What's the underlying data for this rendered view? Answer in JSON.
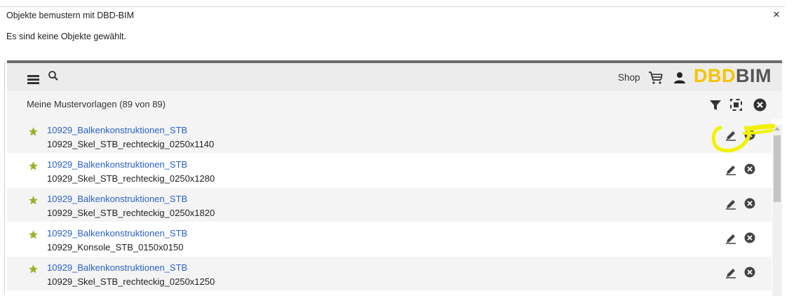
{
  "dialog": {
    "title": "Objekte bemustern mit DBD-BIM",
    "close_symbol": "×",
    "message": "Es sind keine Objekte gewählt."
  },
  "toolbar": {
    "shop_label": "Shop",
    "logo_part1": "DBD",
    "logo_part2": "BIM",
    "icons": [
      "menu-icon",
      "search-icon",
      "cart-icon",
      "user-icon"
    ]
  },
  "list_header": {
    "label": "Meine Mustervorlagen (89 von 89)",
    "icons": [
      "filter-icon",
      "expand-icon",
      "close-all-icon"
    ]
  },
  "items": [
    {
      "title": "10929_Balkenkonstruktionen_STB",
      "subtitle": "10929_Skel_STB_rechteckig_0250x1140"
    },
    {
      "title": "10929_Balkenkonstruktionen_STB",
      "subtitle": "10929_Skel_STB_rechteckig_0250x1280"
    },
    {
      "title": "10929_Balkenkonstruktionen_STB",
      "subtitle": "10929_Skel_STB_rechteckig_0250x1820"
    },
    {
      "title": "10929_Balkenkonstruktionen_STB",
      "subtitle": "10929_Konsole_STB_0150x0150"
    },
    {
      "title": "10929_Balkenkonstruktionen_STB",
      "subtitle": "10929_Skel_STB_rechteckig_0250x1250"
    }
  ],
  "colors": {
    "link": "#2b62c9",
    "star": "#9bb02a",
    "logo_yellow": "#f6c400",
    "logo_gray": "#555555",
    "highlight": "#f2f200"
  }
}
